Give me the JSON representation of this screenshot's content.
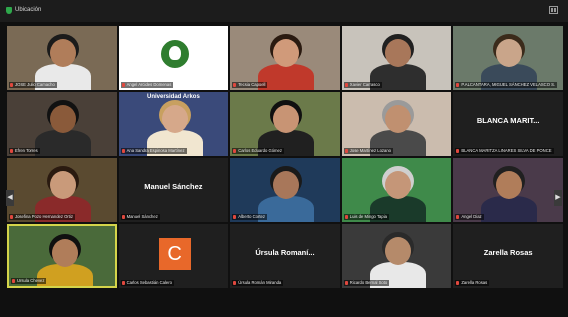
{
  "window": {
    "title": "Ubicación"
  },
  "participants": [
    {
      "label": "JOSE Julio Camacho",
      "type": "video",
      "scene": "man-office"
    },
    {
      "label": "Angel Arcides Domenas",
      "type": "logo",
      "scene": "logo"
    },
    {
      "label": "Tecsia Capoell",
      "type": "video",
      "scene": "woman-red"
    },
    {
      "label": "Xavier Carrasco",
      "type": "video",
      "scene": "man-glasses"
    },
    {
      "label": "P.ALCANTARA, MIGUEL SÁNCHEZ VELASCO S.",
      "type": "video",
      "scene": "man-beard"
    },
    {
      "label": "Efren Torres",
      "type": "video",
      "scene": "man-dark"
    },
    {
      "label": "Ana Sandra Espinosa Martínez",
      "type": "video",
      "scene": "woman-banner",
      "overlay": "Universidad Arkos"
    },
    {
      "label": "Carlos Eduardo Gómez",
      "type": "video",
      "scene": "man-green"
    },
    {
      "label": "Jose Martínez Lozano",
      "type": "video",
      "scene": "man-old"
    },
    {
      "label": "BLANCA MARITZA LINARES SILVA DE PONCE",
      "type": "name",
      "display": "BLANCA MARIT..."
    },
    {
      "label": "Josefina Pozo Hernandez Ortiz",
      "type": "video",
      "scene": "woman-books"
    },
    {
      "label": "Manuel Sánchez",
      "type": "name",
      "display": "Manuel Sánchez"
    },
    {
      "label": "Alberto Cortez",
      "type": "video",
      "scene": "man-blue"
    },
    {
      "label": "Luis de Mingo Tapia",
      "type": "video",
      "scene": "man-slide"
    },
    {
      "label": "Angel Diaz",
      "type": "video",
      "scene": "man-headset"
    },
    {
      "label": "Ursula Chevez",
      "type": "video",
      "scene": "woman-yellow",
      "active": true
    },
    {
      "label": "Carlos Sebastián Calero",
      "type": "initial",
      "display": "C"
    },
    {
      "label": "Úrsula Román Miranda",
      "type": "name",
      "display": "Úrsula Romaní..."
    },
    {
      "label": "Ricardo Bernal Soto",
      "type": "video",
      "scene": "man-white"
    },
    {
      "label": "Zarella Rosas",
      "type": "name",
      "display": "Zarella Rosas"
    }
  ],
  "colors": {
    "active_border": "#d4d44a",
    "mic_muted": "#e0483e",
    "avatar_orange": "#e8682a"
  }
}
